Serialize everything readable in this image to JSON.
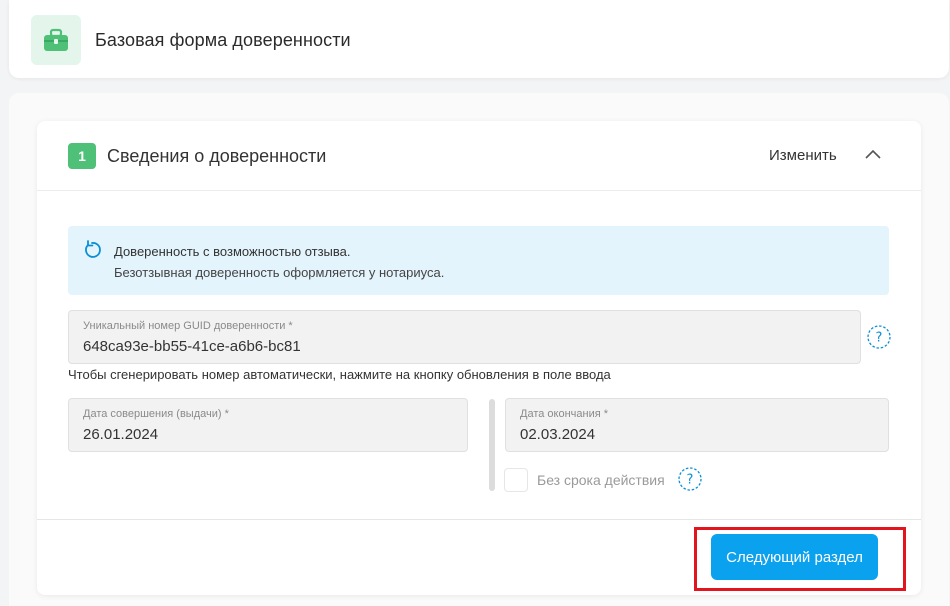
{
  "header": {
    "title": "Базовая форма доверенности",
    "icon": "briefcase-icon"
  },
  "section": {
    "number": "1",
    "title": "Сведения о доверенности",
    "edit_label": "Изменить"
  },
  "info": {
    "line1": "Доверенность с возможностью отзыва.",
    "line2": "Безотзывная доверенность оформляется у нотариуса."
  },
  "guid": {
    "label": "Уникальный номер GUID доверенности *",
    "value": "648ca93e-bb55-41ce-a6b6-bc81",
    "hint": "Чтобы сгенерировать номер автоматически, нажмите на кнопку обновления в поле ввода"
  },
  "issue_date": {
    "label": "Дата совершения (выдачи) *",
    "value": "26.01.2024"
  },
  "end_date": {
    "label": "Дата окончания *",
    "value": "02.03.2024"
  },
  "no_expiry": {
    "label": "Без срока действия",
    "checked": false
  },
  "footer": {
    "next_label": "Следующий раздел"
  },
  "colors": {
    "accent_green": "#4fc077",
    "primary_blue": "#0aa1ee",
    "info_bg": "#e4f4fc",
    "highlight_red": "#e2141e"
  }
}
